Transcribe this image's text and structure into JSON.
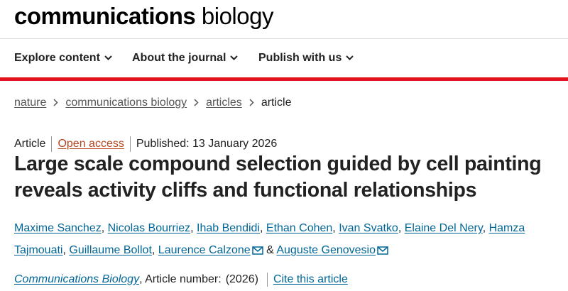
{
  "masthead": {
    "logo_bold": "communications",
    "logo_light": "biology"
  },
  "nav": {
    "items": [
      {
        "label": "Explore content"
      },
      {
        "label": "About the journal"
      },
      {
        "label": "Publish with us"
      }
    ],
    "accent_color": "#e0121e"
  },
  "breadcrumb": {
    "items": [
      "nature",
      "communications biology",
      "articles"
    ],
    "current": "article"
  },
  "article": {
    "type": "Article",
    "access": "Open access",
    "published": "Published: 13 January 2026",
    "title": "Large scale compound selection guided by cell painting reveals activity cliffs and functional relationships",
    "authors": [
      "Maxime Sanchez",
      "Nicolas Bourriez",
      "Ihab Bendidi",
      "Ethan Cohen",
      "Ivan Svatko",
      "Elaine Del Nery",
      "Hamza Tajmouati",
      "Guillaume Bollot",
      "Laurence Calzone",
      "Auguste Genovesio"
    ],
    "author_separator": ",",
    "author_and": "&",
    "journal": "Communications Biology",
    "article_number_label": ", Article number:",
    "year": "(2026)",
    "cite_label": "Cite this article"
  },
  "colors": {
    "link": "#006699",
    "open_access": "#b4451f",
    "text": "#222222"
  }
}
